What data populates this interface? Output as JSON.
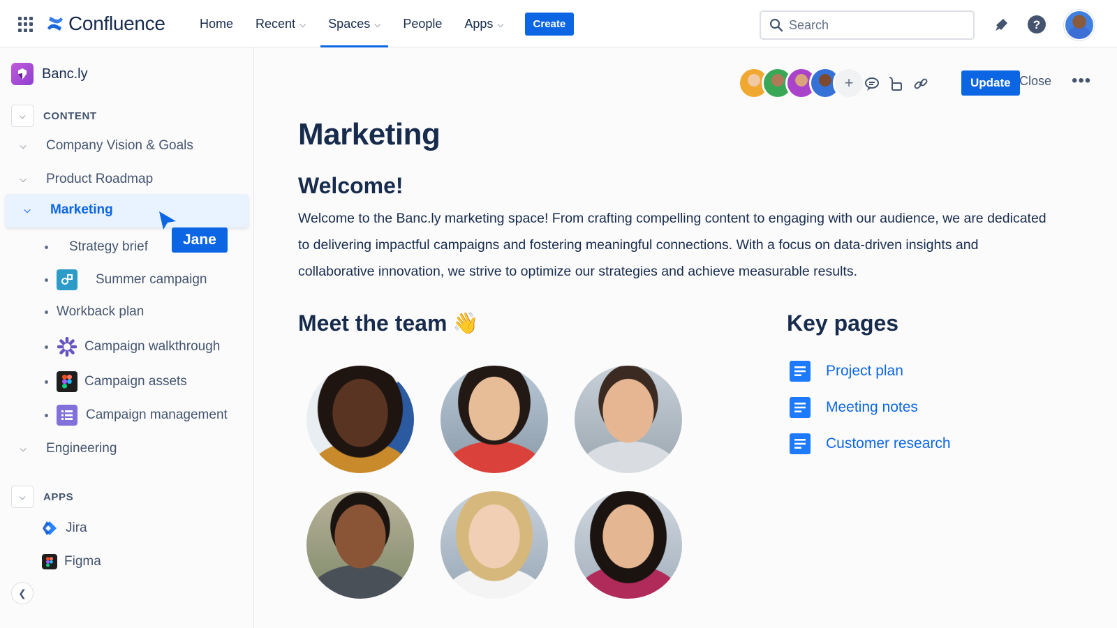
{
  "topnav": {
    "brand": "Confluence",
    "items": [
      {
        "label": "Home",
        "has_chevron": false
      },
      {
        "label": "Recent",
        "has_chevron": true
      },
      {
        "label": "Spaces",
        "has_chevron": true,
        "active": true
      },
      {
        "label": "People",
        "has_chevron": false
      },
      {
        "label": "Apps",
        "has_chevron": true
      }
    ],
    "create_label": "Create",
    "search_placeholder": "Search",
    "icons": [
      "app-switcher-icon",
      "search-icon",
      "notifications-icon",
      "help-icon",
      "user-avatar"
    ]
  },
  "sidebar": {
    "space_name": "Banc.ly",
    "content_section": "CONTENT",
    "tree": [
      {
        "label": "Company Vision & Goals"
      },
      {
        "label": "Product Roadmap"
      },
      {
        "label": "Marketing",
        "selected": true
      }
    ],
    "marketing_children": [
      {
        "label": "Strategy brief",
        "icon": "none"
      },
      {
        "label": "Summer campaign",
        "icon": "whiteboard-icon"
      },
      {
        "label": "Workback plan",
        "icon": "none"
      },
      {
        "label": "Campaign walkthrough",
        "icon": "loom-icon"
      },
      {
        "label": "Campaign assets",
        "icon": "figma-icon"
      },
      {
        "label": "Campaign management",
        "icon": "database-icon"
      }
    ],
    "engineering": "Engineering",
    "apps_section": "APPS",
    "apps": [
      {
        "label": "Jira",
        "icon": "jira-icon"
      },
      {
        "label": "Figma",
        "icon": "figma-icon"
      }
    ],
    "cursor_user": "Jane"
  },
  "toolbar": {
    "update_label": "Update",
    "close_label": "Close",
    "more_label": "•••"
  },
  "page": {
    "title": "Marketing",
    "welcome_heading": "Welcome!",
    "welcome_text": "Welcome to the Banc.ly marketing space! From crafting compelling content to engaging with our audience, we are dedicated to delivering impactful campaigns and fostering meaningful connections. With a focus on data-driven insights and collaborative innovation, we strive to optimize our strategies and achieve measurable results.",
    "team_heading": "Meet the team",
    "team_emoji": "👋",
    "key_heading": "Key pages",
    "key_pages": [
      "Project plan",
      "Meeting notes",
      "Customer research"
    ]
  },
  "colors": {
    "brand_blue": "#0c66e4",
    "text": "#172b4d",
    "subtle": "#44546f",
    "selected_bg": "#e9f2ff"
  }
}
